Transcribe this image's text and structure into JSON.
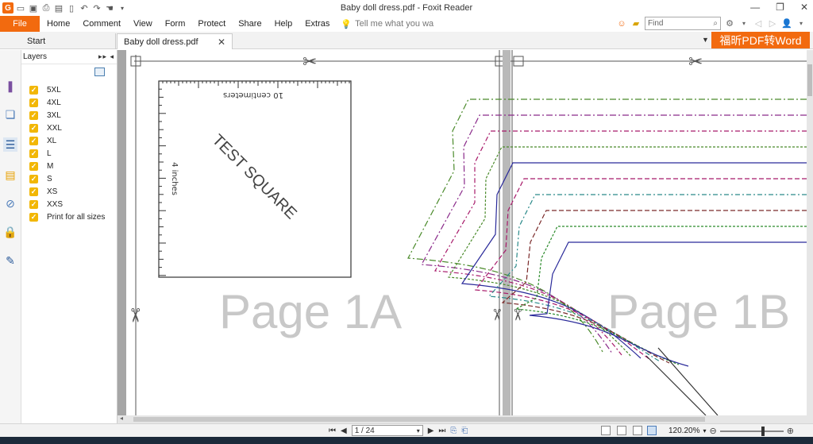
{
  "app": {
    "title": "Baby doll dress.pdf - Foxit Reader",
    "logo_letter": "G"
  },
  "menu": {
    "file": "File",
    "items": [
      "Home",
      "Comment",
      "View",
      "Form",
      "Protect",
      "Share",
      "Help",
      "Extras"
    ],
    "tell_me_placeholder": "Tell me what you wa",
    "find_placeholder": "Find"
  },
  "tabs": {
    "start": "Start",
    "document": "Baby doll dress.pdf"
  },
  "banner": "福昕PDF转Word",
  "layers_panel": {
    "title": "Layers",
    "items": [
      {
        "label": "5XL",
        "checked": true
      },
      {
        "label": "4XL",
        "checked": true
      },
      {
        "label": "3XL",
        "checked": true
      },
      {
        "label": "XXL",
        "checked": true
      },
      {
        "label": "XL",
        "checked": true
      },
      {
        "label": "L",
        "checked": true
      },
      {
        "label": "M",
        "checked": true
      },
      {
        "label": "S",
        "checked": true
      },
      {
        "label": "XS",
        "checked": true
      },
      {
        "label": "XXS",
        "checked": true
      },
      {
        "label": "Print for all sizes",
        "checked": true
      }
    ]
  },
  "document": {
    "test_square_label": "TEST SQUARE",
    "scale_cm": "10 centimeters",
    "scale_in": "4 inches",
    "page_a_label": "Page 1A",
    "page_b_label": "Page 1B"
  },
  "status": {
    "page_display": "1 / 24",
    "zoom": "120.20%"
  },
  "colors": {
    "accent": "#f26a0f",
    "pattern_lines": [
      "#4a8a2a",
      "#8a2a8a",
      "#a81a6a",
      "#4a8a2a",
      "#2a2a9a",
      "#a81a6a",
      "#2a8a8a",
      "#7a2a2a",
      "#2a8a2a",
      "#2a2a9a"
    ]
  }
}
